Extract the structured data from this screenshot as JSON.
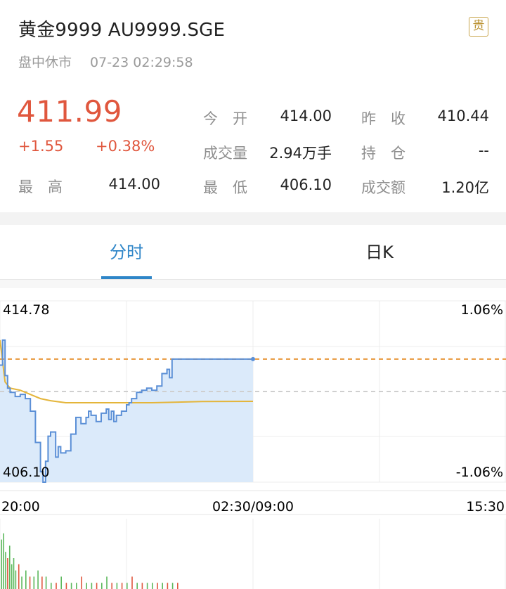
{
  "header": {
    "title": "黄金9999 AU9999.SGE",
    "badge": "贵",
    "status": "盘中休市",
    "datetime": "07-23 02:29:58"
  },
  "quote": {
    "price": "411.99",
    "change": "+1.55",
    "change_pct": "+0.38%",
    "high_label": "最　高",
    "high_value": "414.00",
    "open_label": "今　开",
    "open_value": "414.00",
    "volume_label": "成交量",
    "volume_value": "2.94万手",
    "low_label": "最　低",
    "low_value": "406.10",
    "prev_close_label": "昨　收",
    "prev_close_value": "410.44",
    "position_label": "持　仓",
    "position_value": "--",
    "turnover_label": "成交额",
    "turnover_value": "1.20亿"
  },
  "tabs": [
    {
      "label": "分时",
      "active": true
    },
    {
      "label": "日K",
      "active": false
    }
  ],
  "chart_data": {
    "type": "line",
    "title": "",
    "y_top_label": "414.78",
    "y_bottom_label": "406.10",
    "pct_top_label": "1.06%",
    "pct_bottom_label": "-1.06%",
    "ylim": [
      406.1,
      414.78
    ],
    "prev_close": 410.44,
    "current": 411.99,
    "x_labels": [
      "20:00",
      "02:30/09:00",
      "15:30"
    ],
    "series": [
      {
        "name": "price",
        "color": "#5b8fd6",
        "x": [
          0,
          0.005,
          0.01,
          0.015,
          0.02,
          0.03,
          0.04,
          0.05,
          0.06,
          0.07,
          0.08,
          0.085,
          0.09,
          0.095,
          0.1,
          0.11,
          0.115,
          0.12,
          0.13,
          0.14,
          0.15,
          0.16,
          0.17,
          0.175,
          0.18,
          0.19,
          0.2,
          0.21,
          0.215,
          0.22,
          0.225,
          0.23,
          0.24,
          0.25,
          0.255,
          0.26,
          0.27,
          0.28,
          0.29,
          0.3,
          0.31,
          0.32,
          0.33,
          0.335,
          0.34,
          0.345,
          0.35,
          0.5
        ],
        "values": [
          411.7,
          412.9,
          411.2,
          410.6,
          410.4,
          410.2,
          410.3,
          410.1,
          409.5,
          408.0,
          406.6,
          406.1,
          407.1,
          408.3,
          408.5,
          407.3,
          407.8,
          407.5,
          407.6,
          408.4,
          409.2,
          408.9,
          409.2,
          409.5,
          409.3,
          409.0,
          409.4,
          409.6,
          409.1,
          409.5,
          409.0,
          409.3,
          409.5,
          409.8,
          409.9,
          410.1,
          410.4,
          410.5,
          410.6,
          410.5,
          410.7,
          411.3,
          411.5,
          411.1,
          411.99,
          411.99,
          411.99,
          411.99
        ]
      },
      {
        "name": "average",
        "color": "#e4b53a",
        "x": [
          0,
          0.01,
          0.02,
          0.04,
          0.06,
          0.08,
          0.1,
          0.13,
          0.16,
          0.2,
          0.25,
          0.3,
          0.4,
          0.5
        ],
        "values": [
          412.9,
          410.9,
          410.6,
          410.5,
          410.3,
          410.1,
          410.0,
          409.9,
          409.9,
          409.9,
          409.9,
          409.9,
          409.96,
          409.97
        ]
      }
    ],
    "volume": {
      "x": [
        0.002,
        0.006,
        0.01,
        0.014,
        0.018,
        0.022,
        0.026,
        0.03,
        0.036,
        0.042,
        0.05,
        0.058,
        0.066,
        0.074,
        0.082,
        0.09,
        0.1,
        0.11,
        0.12,
        0.13,
        0.14,
        0.15,
        0.16,
        0.17,
        0.18,
        0.19,
        0.2,
        0.21,
        0.22,
        0.23,
        0.24,
        0.25,
        0.26,
        0.27,
        0.28,
        0.29,
        0.3,
        0.31,
        0.32,
        0.33,
        0.34,
        0.35
      ],
      "values": [
        8,
        9,
        6,
        5,
        7,
        4,
        5,
        3,
        4,
        2,
        3,
        2,
        2,
        3,
        2,
        2,
        1,
        1,
        2,
        1,
        1,
        1,
        2,
        1,
        1,
        1,
        1,
        2,
        1,
        1,
        1,
        1,
        2,
        1,
        1,
        1,
        1,
        1,
        1,
        1,
        1,
        1
      ],
      "colors": [
        "green",
        "green",
        "green",
        "red",
        "green",
        "green",
        "green",
        "green",
        "red",
        "green",
        "green",
        "red",
        "green",
        "green",
        "red",
        "green",
        "green",
        "red",
        "green",
        "red",
        "green",
        "green",
        "red",
        "green",
        "green",
        "red",
        "green",
        "green",
        "red",
        "green",
        "red",
        "green",
        "red",
        "green",
        "red",
        "green",
        "green",
        "red",
        "green",
        "red",
        "green",
        "red"
      ]
    },
    "grid": true
  },
  "colors": {
    "up": "#e0573e",
    "accent": "#2f86c8",
    "prev_close_line": "#e8963a"
  }
}
